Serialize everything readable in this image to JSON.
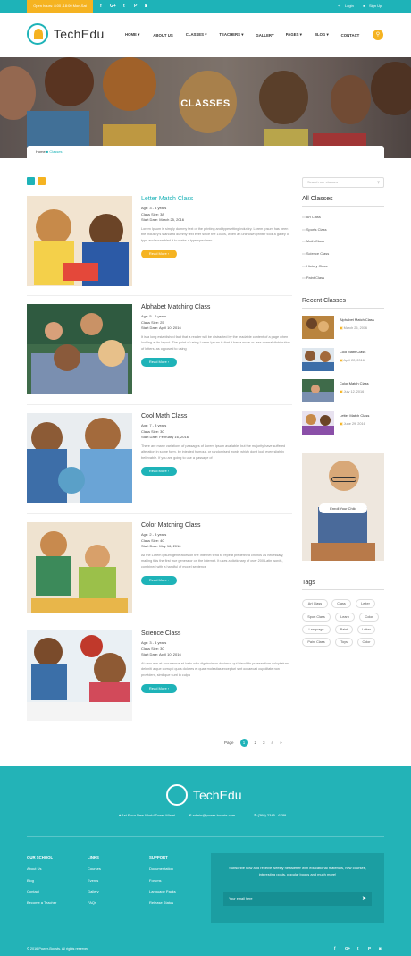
{
  "topbar": {
    "hours": "Open hours: 8:00 -18:00 Mon-Sat",
    "social": [
      "f",
      "G+",
      "t",
      "P",
      "◙"
    ],
    "login": "Login",
    "signup": "Sign Up"
  },
  "header": {
    "logo": "TechEdu",
    "nav": [
      "HOME",
      "ABOUT US",
      "CLASSES",
      "TEACHERS",
      "GALLERY",
      "PAGES",
      "BLOG",
      "CONTACT"
    ]
  },
  "hero": {
    "title": "CLASSES"
  },
  "breadcrumb": {
    "home": "Home",
    "current": "Classes"
  },
  "courses": [
    {
      "title": "Letter Match Class",
      "age": "Age: 3 - 4 years",
      "size": "Class Size: 38",
      "start": "Start Date: March 25, 2016",
      "desc": "Lorem Ipsum is simply dummy text of the printing and typesetting industry. Lorem Ipsum has been the industry's standard dummy text ever since the 1500s, when an unknown printer took a galley of type and scrambled it to make a type specimen.",
      "btn": "Read More"
    },
    {
      "title": "Alphabet Matching Class",
      "age": "Age: 5 - 6 years",
      "size": "Class Size: 25",
      "start": "Start Date: April 10, 2016",
      "desc": "It is a long established fact that a reader will be distracted by the readable content of a page when looking at its layout. The point of using Lorem Ipsum is that it has a more-or-less normal distribution of letters, as opposed to using",
      "btn": "Read More"
    },
    {
      "title": "Cool Math Class",
      "age": "Age: 7 - 8 years",
      "size": "Class Size: 30",
      "start": "Start Date: February 16, 2016",
      "desc": "There are many variations of passages of Lorem Ipsum available, but the majority have suffered alteration in some form, by injected humour, or randomised words which don't look even slightly believable. If you are going to use a passage of",
      "btn": "Read More"
    },
    {
      "title": "Color Matching Class",
      "age": "Age: 2 - 3 years",
      "size": "Class Size: 40",
      "start": "Start Date: May 16, 2016",
      "desc": "All the Lorem Ipsum generators on the Internet tend to repeat predefined chunks as necessary, making this the first true generator on the Internet. It uses a dictionary of over 200 Latin words, combined with a handful of model sentence",
      "btn": "Read More"
    },
    {
      "title": "Science Class",
      "age": "Age: 3 - 4 years",
      "size": "Class Size: 30",
      "start": "Start Date: April 10, 2016",
      "desc": "At vero eos et accusamus et iusto odio dignissimos ducimus qui blanditiis praesentium voluptatum deleniti atque corrupti quos dolores et quas molestias excepturi sint occaecati cupiditate non provident, similique sunt in culpa",
      "btn": "Read More"
    }
  ],
  "pagination": {
    "label": "Page",
    "pages": [
      "1",
      "2",
      "3",
      "4"
    ],
    "next": "»"
  },
  "sidebar": {
    "search_placeholder": "Search our classes",
    "all_title": "All Classes",
    "categories": [
      "Art Class",
      "Sports Class",
      "Math Class",
      "Science Class",
      "History Class",
      "Paint Class"
    ],
    "recent_title": "Recent Classes",
    "recent": [
      {
        "name": "Alphabet Match Class",
        "date": "March 25, 2016"
      },
      {
        "name": "Cool Math Class",
        "date": "April 22, 2016"
      },
      {
        "name": "Color Match Class",
        "date": "July 12, 2016"
      },
      {
        "name": "Letter Match Class",
        "date": "June 29, 2016"
      }
    ],
    "enroll": "Enroll Your Child",
    "tags_title": "Tags",
    "tags": [
      "Art Class",
      "Class",
      "Letter",
      "Sport Class",
      "Learn",
      "Color",
      "Language",
      "Paint",
      "Letter",
      "Paint Class",
      "Toys",
      "Color"
    ]
  },
  "footer": {
    "logo": "TechEdu",
    "address": "1st Floor New World Tower Miami",
    "email": "admin@power-boosts.com",
    "phone": "(360) 2345 - 6789",
    "school_title": "OUR SCHOOL",
    "school": [
      "About Us",
      "Blog",
      "Contact",
      "Become a Teacher"
    ],
    "links_title": "LINKS",
    "links": [
      "Courses",
      "Events",
      "Gallery",
      "FAQs"
    ],
    "support_title": "SUPPORT",
    "support": [
      "Documentation",
      "Forums",
      "Language Packs",
      "Release Status"
    ],
    "newsletter_text": "Subscribe now and receive weekly newsletter with educational materials, new courses, interesting posts, popular books and much more!",
    "email_placeholder": "Your email here",
    "copyright": "© 2016 Power-Boosts. All rights reserved",
    "social": [
      "f",
      "G+",
      "t",
      "P",
      "◙"
    ]
  },
  "colors": {
    "teal": "#1eb3b8",
    "yellow": "#f5b321"
  }
}
